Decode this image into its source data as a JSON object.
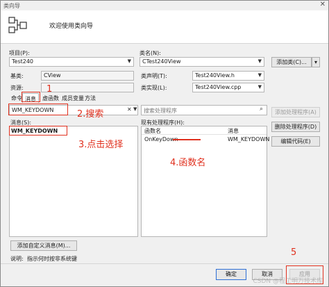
{
  "window": {
    "title": "类向导",
    "close_glyph": "✕"
  },
  "header": {
    "title": "欢迎使用类向导",
    "logo_icon": "class-wizard-icon"
  },
  "project": {
    "label": "项目(P):",
    "value": "Test240"
  },
  "classname": {
    "label": "类名(N):",
    "value": "CTest240View"
  },
  "add_class_button": {
    "label": "添加类(C)...",
    "split_glyph": "▾"
  },
  "base": {
    "label": "基类:",
    "value": "CView"
  },
  "class_decl": {
    "label": "类声明(T):",
    "value": "Test240View.h"
  },
  "resource": {
    "label": "资源:",
    "value": ""
  },
  "class_impl": {
    "label": "类实现(L):",
    "value": "Test240View.cpp"
  },
  "tabs": [
    {
      "label": "命令"
    },
    {
      "label": "消息",
      "active": true
    },
    {
      "label": "虚函数"
    },
    {
      "label": "成员变量"
    },
    {
      "label": "方法"
    }
  ],
  "message_search": {
    "value": "WM_KEYDOWN"
  },
  "handler_search": {
    "placeholder": "搜索处理程序"
  },
  "messages": {
    "label": "消息(S):",
    "items": [
      "WM_KEYDOWN"
    ]
  },
  "handlers": {
    "label": "现有处理程序(H):",
    "columns": [
      "函数名",
      "消息"
    ],
    "rows": [
      {
        "func": "OnKeyDown",
        "msg": "WM_KEYDOWN"
      }
    ]
  },
  "side_buttons": {
    "add_handler": "添加处理程序(A)",
    "delete_handler": "删除处理程序(D)",
    "edit_code": "编辑代码(E)"
  },
  "add_custom_message": "添加自定义消息(M)...",
  "description": {
    "label": "说明:",
    "text": "指示何时按非系统键"
  },
  "footer": {
    "ok": "确定",
    "cancel": "取消",
    "apply": "应用"
  },
  "annotations": {
    "a1": "1",
    "a2": "2.搜索",
    "a3": "3.点击选择",
    "a4": "4.函数名",
    "a5": "5"
  },
  "watermark": "CSDN @程工明万技术库",
  "colors": {
    "annotation": "#e0301e",
    "default_button_border": "#2f6fd6"
  }
}
